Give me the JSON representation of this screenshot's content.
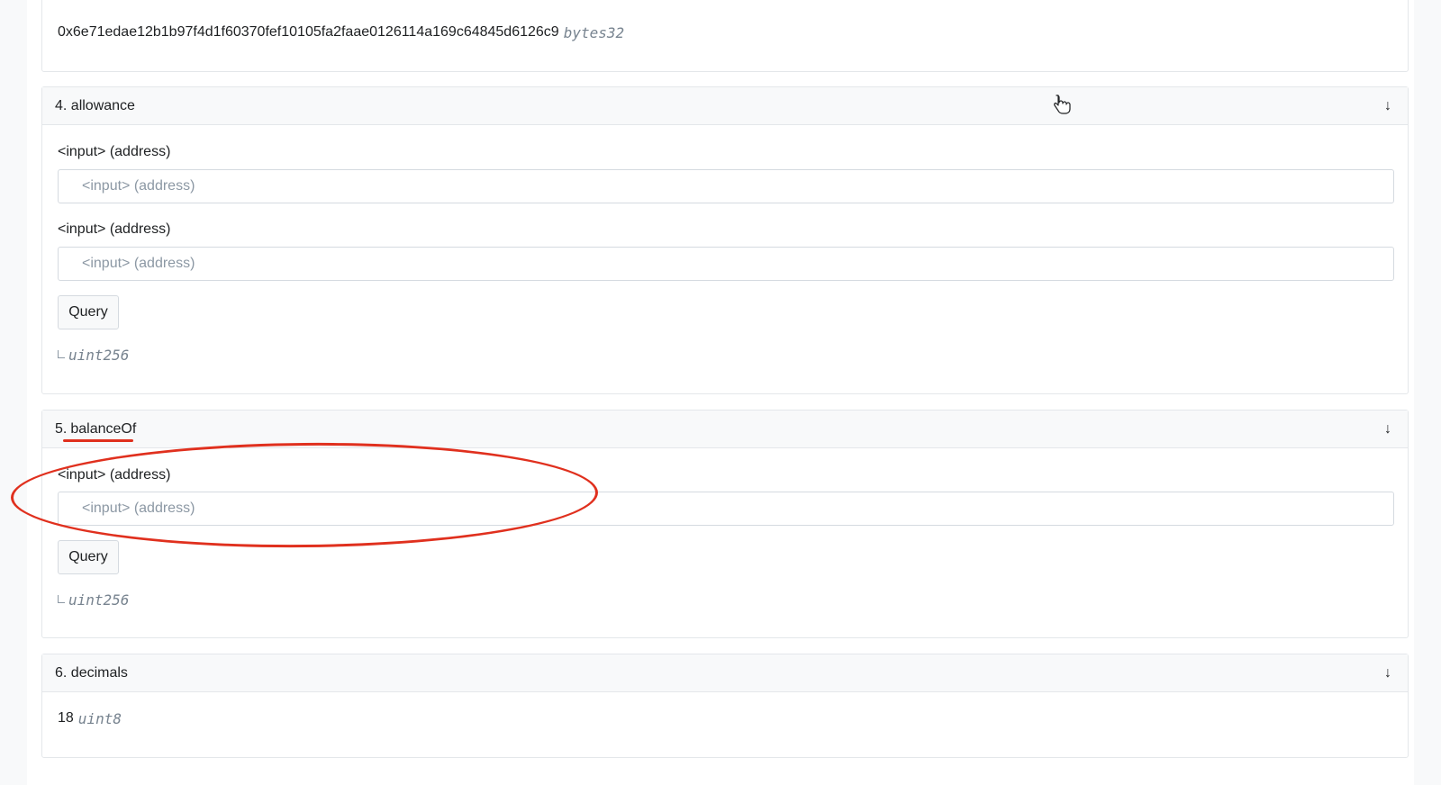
{
  "top_card": {
    "value": "0x6e71edae12b1b97f4d1f60370fef10105fa2faae0126114a169c64845d6126c9",
    "type": "bytes32"
  },
  "allowance": {
    "title": "4. allowance",
    "input1_label": "<input> (address)",
    "input1_placeholder": "<input> (address)",
    "input2_label": "<input> (address)",
    "input2_placeholder": "<input> (address)",
    "query_label": "Query",
    "return_type": "uint256"
  },
  "balanceOf": {
    "title_num": "5.",
    "title_name": "balanceOf",
    "input_label": "<input> (address)",
    "input_placeholder": "<input> (address)",
    "query_label": "Query",
    "return_type": "uint256"
  },
  "decimals": {
    "title": "6. decimals",
    "value": "18",
    "type": "uint8"
  },
  "icons": {
    "expand": "arrow-down-icon",
    "cursor": "hand-pointer-icon"
  },
  "colors": {
    "annotation": "#e0301e",
    "header_bg": "#f8f9fa",
    "border": "#e4e7ea"
  }
}
